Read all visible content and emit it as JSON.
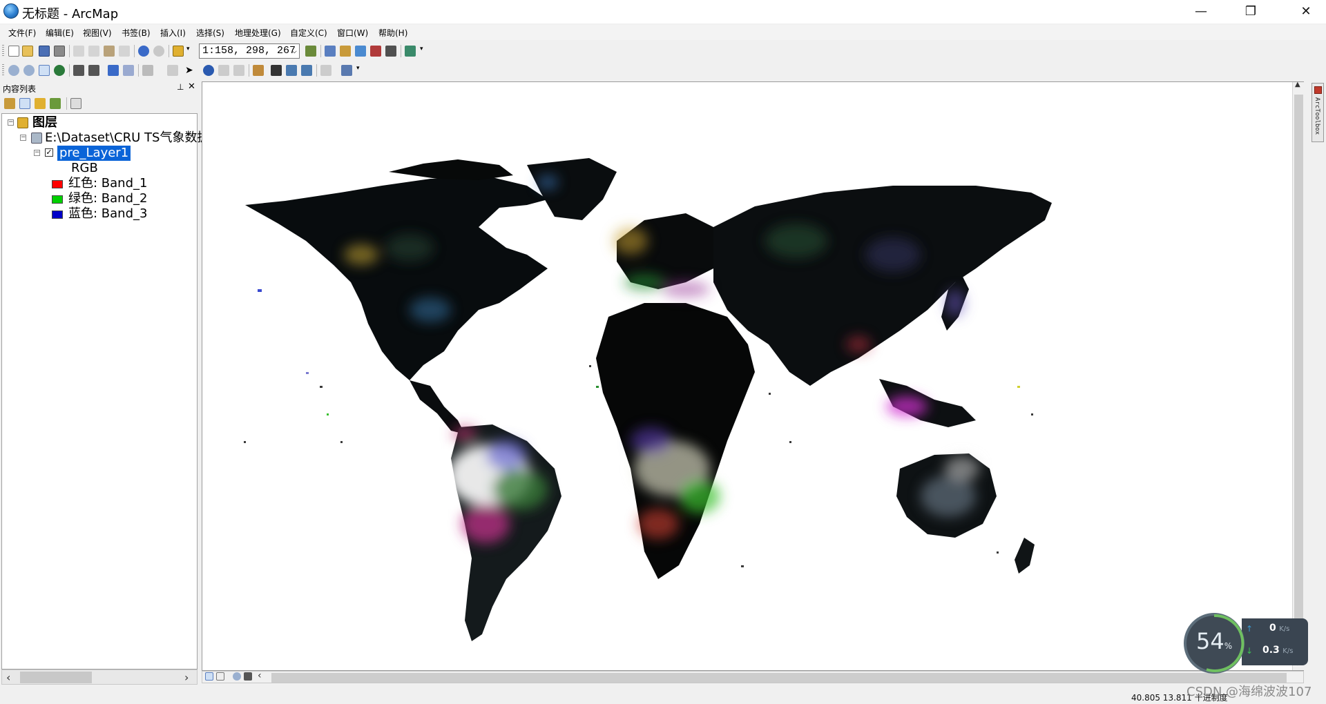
{
  "window": {
    "title": "无标题 - ArcMap",
    "minimize_glyph": "—",
    "restore_glyph": "❐",
    "close_glyph": "✕"
  },
  "menu": {
    "items": [
      "文件(F)",
      "编辑(E)",
      "视图(V)",
      "书签(B)",
      "插入(I)",
      "选择(S)",
      "地理处理(G)",
      "自定义(C)",
      "窗口(W)",
      "帮助(H)"
    ]
  },
  "toolbar": {
    "scale_value": "1:158, 298, 267",
    "scale_arrow_glyph": "⌵"
  },
  "toc": {
    "panel_title": "内容列表",
    "pin_glyph": "📌",
    "close_glyph": "✕",
    "root_label": "图层",
    "dataset_label": "E:\\Dataset\\CRU TS气象数据",
    "layer_label": "pre_Layer1",
    "renderer_label": "RGB",
    "bands": [
      {
        "label": "红色:   Band_1",
        "color": "#ff0000"
      },
      {
        "label": "绿色: Band_2",
        "color": "#00d000"
      },
      {
        "label": "蓝色:   Band_3",
        "color": "#0000c8"
      }
    ]
  },
  "toolbox": {
    "label": "ArcToolbox"
  },
  "status": {
    "coords": "40.805  13.811 十进制度"
  },
  "watermark": {
    "text": "CSDN @海绵波波107"
  },
  "network": {
    "percent": "54",
    "percent_unit": "%",
    "upload": "0",
    "download": "0.3",
    "speed_unit": "K/s"
  }
}
